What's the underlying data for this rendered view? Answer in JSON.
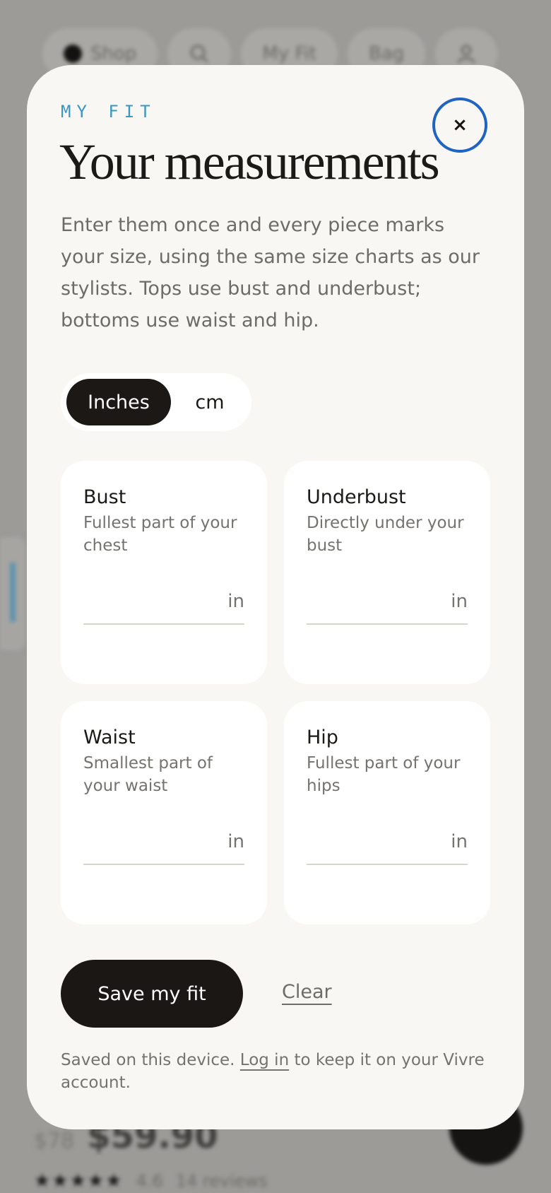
{
  "background": {
    "nav": {
      "shop_label": "Shop",
      "myfit_label": "My Fit",
      "bag_label": "Bag"
    },
    "price": {
      "old": "$78",
      "current": "$59.90"
    },
    "rating": {
      "stars": "★★★★★",
      "value": "4.6",
      "reviews": "14 reviews"
    }
  },
  "modal": {
    "eyebrow": "MY FIT",
    "title": "Your measurements",
    "close_icon": "×",
    "intro": "Enter them once and every piece marks your size, using the same size charts as our stylists. Tops use bust and underbust; bottoms use waist and hip.",
    "units": {
      "inches": "Inches",
      "cm": "cm",
      "selected": "Inches"
    },
    "fields": [
      {
        "label": "Bust",
        "hint": "Fullest part of your chest",
        "value": "",
        "unit": "in"
      },
      {
        "label": "Underbust",
        "hint": "Directly under your bust",
        "value": "",
        "unit": "in"
      },
      {
        "label": "Waist",
        "hint": "Smallest part of your waist",
        "value": "",
        "unit": "in"
      },
      {
        "label": "Hip",
        "hint": "Fullest part of your hips",
        "value": "",
        "unit": "in"
      }
    ],
    "save_label": "Save my fit",
    "clear_label": "Clear",
    "footnote": {
      "before": "Saved on this device.",
      "link": "Log in",
      "after": "to keep it on your Vivre account."
    }
  },
  "colors": {
    "accent": "#3b97c2",
    "dark": "#1c1815",
    "focus_ring": "#1f63c3",
    "panel": "#f8f7f4"
  }
}
